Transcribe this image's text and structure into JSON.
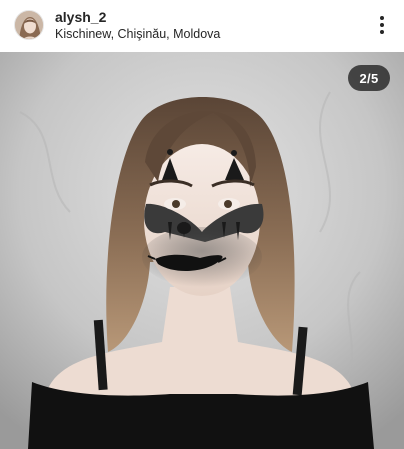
{
  "post": {
    "username": "alysh_2",
    "location": "Kischinew, Chişinău, Moldova",
    "carousel_counter": "2/5"
  },
  "icons": {
    "more": "more-vertical-icon"
  }
}
